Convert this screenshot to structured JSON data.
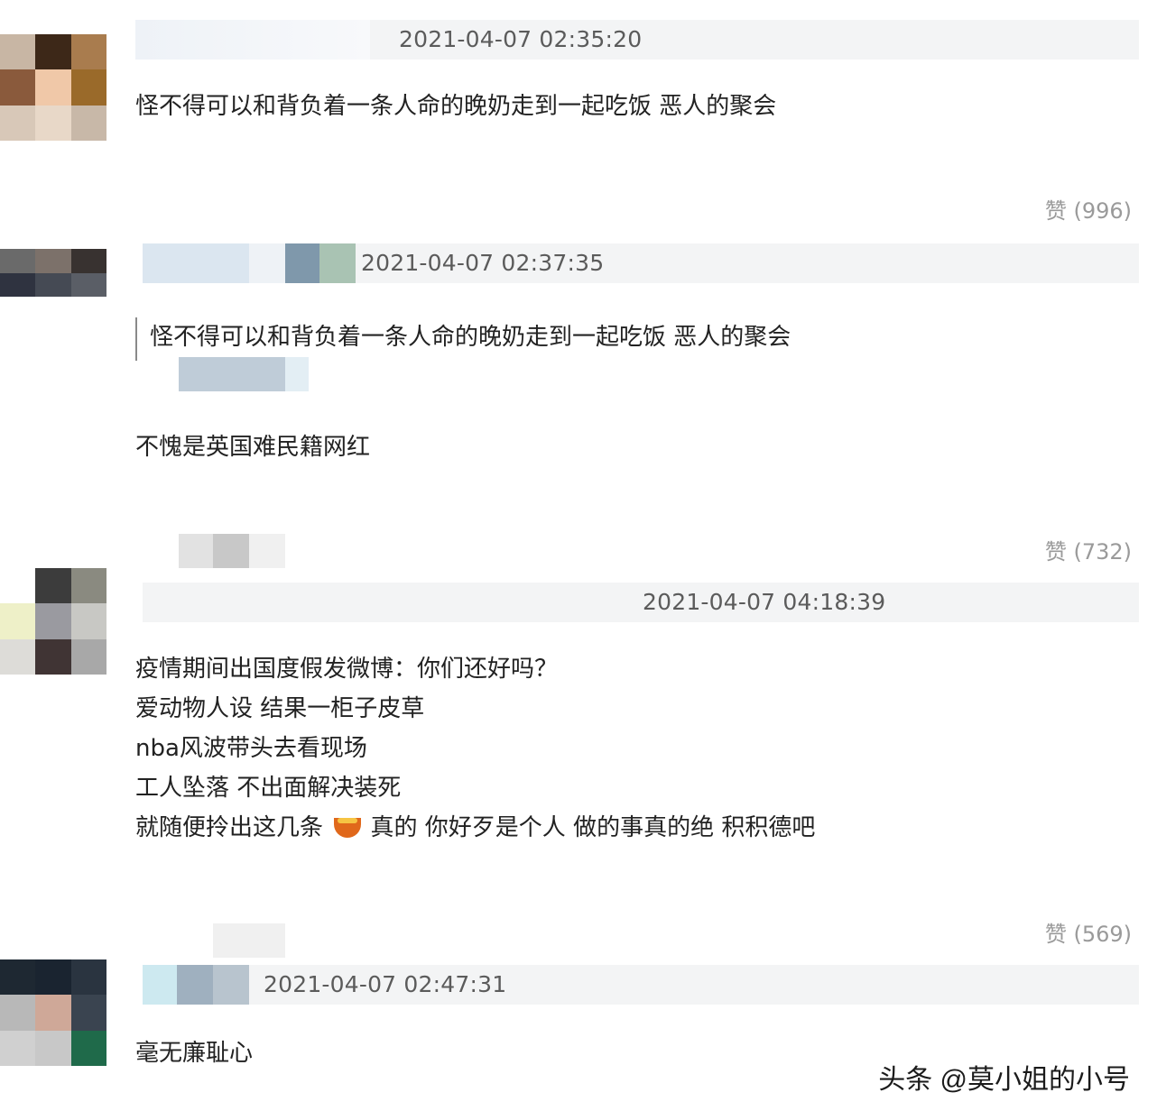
{
  "comments": [
    {
      "timestamp": "2021-04-07 02:35:20",
      "lines": [
        "怪不得可以和背负着一条人命的晚奶走到一起吃饭 恶人的聚会"
      ],
      "likes": "赞 (996)"
    },
    {
      "timestamp": "2021-04-07 02:37:35",
      "quote": "怪不得可以和背负着一条人命的晚奶走到一起吃饭 恶人的聚会",
      "lines": [
        "不愧是英国难民籍网红"
      ],
      "likes": "赞 (732)"
    },
    {
      "timestamp": "2021-04-07 04:18:39",
      "lines": [
        "疫情期间出国度假发微博：你们还好吗？",
        "爱动物人设 结果一柜子皮草",
        "nba风波带头去看现场",
        "工人坠落 不出面解决装死"
      ],
      "last_line_before": "就随便拎出这几条",
      "last_line_emoji": "bowl-emoji",
      "last_line_after": "真的 你好歹是个人 做的事真的绝 积积德吧",
      "likes": "赞 (569)"
    },
    {
      "timestamp": "2021-04-07 02:47:31",
      "lines": [
        "毫无廉耻心"
      ]
    }
  ],
  "watermark": "头条 @莫小姐的小号",
  "colors": {
    "meta_bar": "#f3f4f5",
    "text": "#222222",
    "likes": "#9a9a9a"
  }
}
